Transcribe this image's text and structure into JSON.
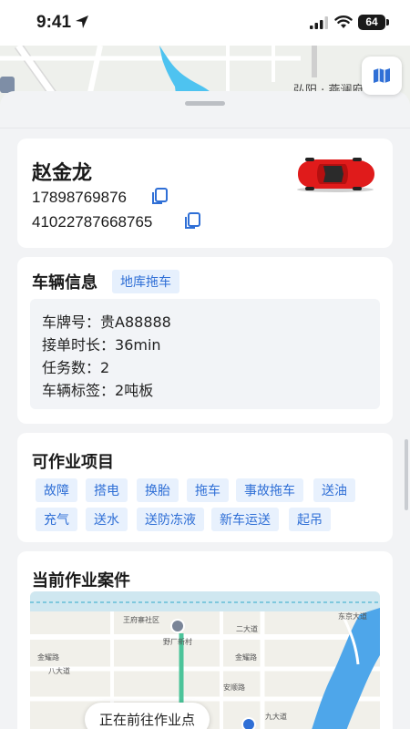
{
  "status_bar": {
    "time": "9:41",
    "battery": "64"
  },
  "top_map": {
    "road_label": "弘阳 · 燕澜府"
  },
  "customer": {
    "name": "赵金龙",
    "phone": "17898769876",
    "id_number": "41022787668765"
  },
  "vehicle": {
    "title": "车辆信息",
    "tag": "地库拖车",
    "rows": [
      {
        "label": "车牌号：",
        "value": "贵A88888"
      },
      {
        "label": "接单时长：",
        "value": "36min"
      },
      {
        "label": "任务数：",
        "value": "2"
      },
      {
        "label": "车辆标签：",
        "value": "2吨板"
      }
    ]
  },
  "services": {
    "title": "可作业项目",
    "items": [
      "故障",
      "搭电",
      "换胎",
      "拖车",
      "事故拖车",
      "送油",
      "充气",
      "送水",
      "送防冻液",
      "新车运送",
      "起吊"
    ]
  },
  "current_job": {
    "title": "当前作业案件",
    "status_text": "正在前往作业点",
    "map_labels": [
      "王府寨社区",
      "野厂新村",
      "东京大道",
      "金耀路",
      "金耀路",
      "安顺路",
      "二大道",
      "八大道",
      "九大道"
    ]
  },
  "colors": {
    "accent": "#2f6fd6",
    "chip_bg": "#e8f1fd",
    "card_bg": "#ffffff",
    "sheet_bg": "#f2f3f5"
  }
}
